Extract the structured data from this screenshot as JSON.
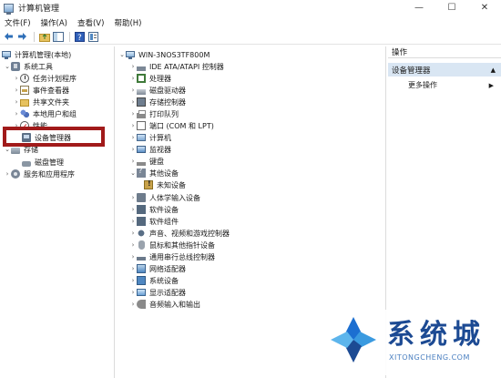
{
  "window": {
    "title": "计算机管理",
    "minimize": "—",
    "maximize": "☐",
    "close": "✕"
  },
  "menu": [
    "文件(F)",
    "操作(A)",
    "查看(V)",
    "帮助(H)"
  ],
  "toolbar_icons": [
    "back-arrow-icon",
    "forward-arrow-icon",
    "up-folder-icon",
    "show-hide-tree-icon",
    "help-icon",
    "properties-icon"
  ],
  "left_tree": {
    "root": "计算机管理(本地)",
    "system_tools": "系统工具",
    "task_scheduler": "任务计划程序",
    "event_viewer": "事件查看器",
    "shared_folders": "共享文件夹",
    "local_users": "本地用户和组",
    "performance": "性能",
    "device_manager": "设备管理器",
    "storage": "存储",
    "disk_management": "磁盘管理",
    "services_apps": "服务和应用程序"
  },
  "device_tree": {
    "computer": "WIN-3NOS3TF800M",
    "categories": [
      "IDE ATA/ATAPI 控制器",
      "处理器",
      "磁盘驱动器",
      "存储控制器",
      "打印队列",
      "端口 (COM 和 LPT)",
      "计算机",
      "监视器",
      "键盘",
      "其他设备",
      "未知设备",
      "人体学输入设备",
      "软件设备",
      "软件组件",
      "声音、视频和游戏控制器",
      "鼠标和其他指针设备",
      "通用串行总线控制器",
      "网络适配器",
      "系统设备",
      "显示适配器",
      "音频输入和输出"
    ]
  },
  "actions": {
    "header": "操作",
    "section": "设备管理器",
    "more": "更多操作"
  },
  "watermark": {
    "text": "系统城",
    "sub": "XITONGCHENG.COM"
  }
}
